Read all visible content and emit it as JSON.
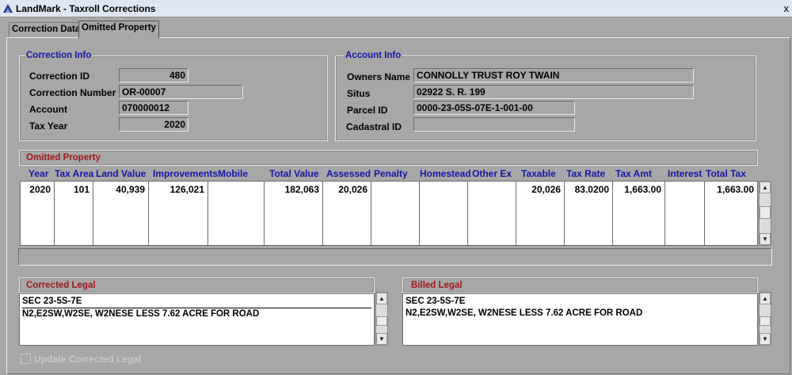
{
  "window": {
    "title": "LandMark - Taxroll Corrections",
    "close_label": "x"
  },
  "tabs": [
    "Correction Data",
    "Omitted Property"
  ],
  "correction_info": {
    "legend": "Correction Info",
    "fields": [
      {
        "label": "Correction ID",
        "value": "480"
      },
      {
        "label": "Correction Number",
        "value": "OR-00007"
      },
      {
        "label": "Account",
        "value": "070000012"
      },
      {
        "label": "Tax Year",
        "value": "2020"
      }
    ]
  },
  "account_info": {
    "legend": "Account Info",
    "fields": [
      {
        "label": "Owners Name",
        "value": "CONNOLLY TRUST ROY TWAIN"
      },
      {
        "label": "Situs",
        "value": "02922 S. R. 199"
      },
      {
        "label": "Parcel ID",
        "value": "0000-23-05S-07E-1-001-00"
      },
      {
        "label": "Cadastral ID",
        "value": ""
      }
    ]
  },
  "omitted_property": {
    "legend": "Omitted Property",
    "columns": [
      "Year",
      "Tax Area",
      "Land Value",
      "Improvements",
      "Mobile",
      "Total Value",
      "Assessed",
      "Penalty",
      "Homestead",
      "Other Ex",
      "Taxable",
      "Tax Rate",
      "Tax Amt",
      "Interest",
      "Total Tax"
    ],
    "row": [
      "2020",
      "101",
      "40,939",
      "126,021",
      "",
      "182,063",
      "20,026",
      "",
      "",
      "",
      "20,026",
      "83.0200",
      "1,663.00",
      "",
      "1,663.00"
    ]
  },
  "corrected_legal": {
    "legend": "Corrected Legal",
    "lines": [
      "SEC 23-5S-7E",
      "N2,E2SW,W2SE, W2NESE LESS 7.62 ACRE FOR ROAD"
    ]
  },
  "billed_legal": {
    "legend": "Billed Legal",
    "lines": [
      "SEC 23-5S-7E",
      "N2,E2SW,W2SE, W2NESE LESS 7.62 ACRE FOR ROAD"
    ]
  },
  "update_checkbox": {
    "label": "Update Corrected Legal",
    "checked": false
  },
  "colors": {
    "legend_blue": "#1717a6",
    "legend_red": "#a11919",
    "background": "#a7a7a7"
  }
}
